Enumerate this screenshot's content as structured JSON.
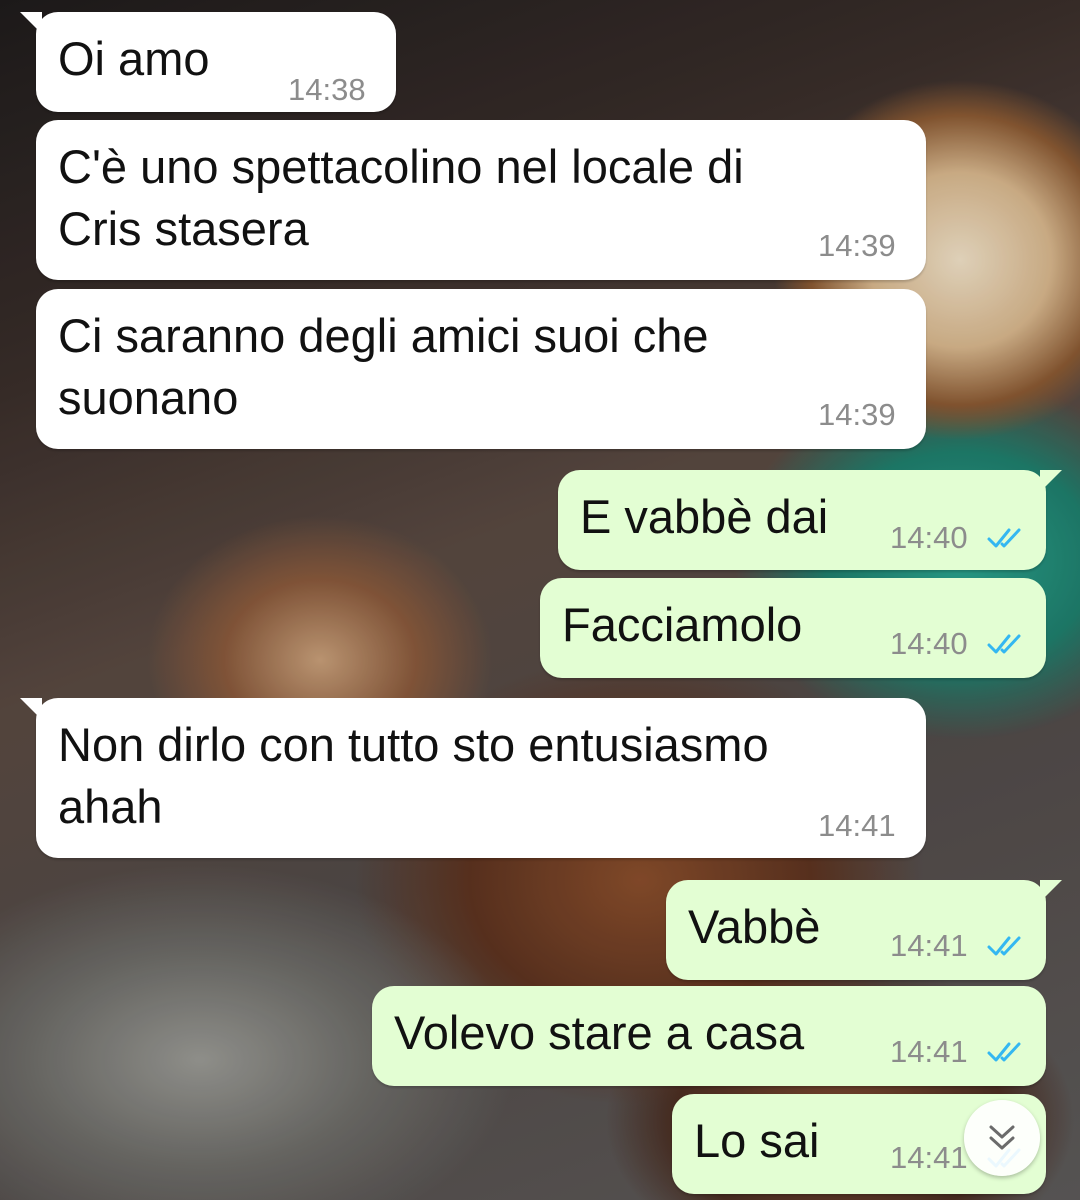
{
  "chat": {
    "messages": [
      {
        "text": "Oi amo",
        "time": "14:38",
        "direction": "in"
      },
      {
        "text": "C'è uno spettacolino nel locale di\nCris stasera",
        "time": "14:39",
        "direction": "in"
      },
      {
        "text": "Ci saranno degli amici suoi che\nsuonano",
        "time": "14:39",
        "direction": "in"
      },
      {
        "text": "E vabbè dai",
        "time": "14:40",
        "direction": "out",
        "status": "read"
      },
      {
        "text": "Facciamolo",
        "time": "14:40",
        "direction": "out",
        "status": "read"
      },
      {
        "text": "Non dirlo con tutto sto entusiasmo\nahah",
        "time": "14:41",
        "direction": "in"
      },
      {
        "text": "Vabbè",
        "time": "14:41",
        "direction": "out",
        "status": "read"
      },
      {
        "text": "Volevo stare a casa",
        "time": "14:41",
        "direction": "out",
        "status": "read"
      },
      {
        "text": "Lo sai",
        "time": "14:41",
        "direction": "out",
        "status": "read"
      }
    ]
  },
  "icons": {
    "read_receipt": "double-check-icon",
    "scroll_down": "double-chevron-down-icon"
  },
  "colors": {
    "incoming_bubble": "#ffffff",
    "outgoing_bubble": "#e3fed3",
    "read_tick": "#34b7f1",
    "timestamp": "#8c8c8c"
  }
}
